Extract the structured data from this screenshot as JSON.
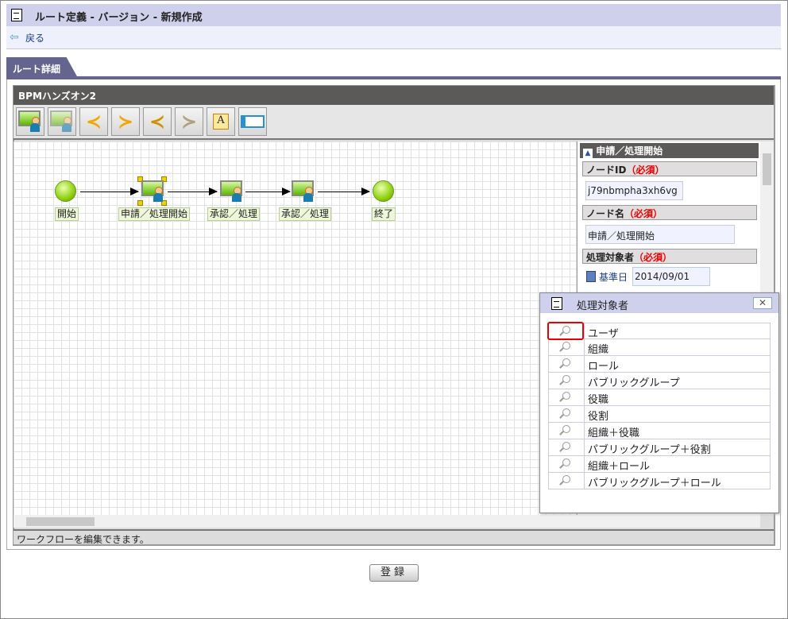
{
  "header": {
    "title": "ルート定義 - バージョン - 新規作成",
    "back_label": "戻る"
  },
  "tab": {
    "label": "ルート詳細"
  },
  "editor": {
    "title": "BPMハンズオン2",
    "status": "ワークフローを編集できます。",
    "toolbar": [
      "user-node-icon",
      "user-node-alt-icon",
      "split-icon",
      "join-icon",
      "split-alt-icon",
      "join-alt-icon",
      "annotation-icon",
      "swimlane-icon"
    ],
    "nodes": [
      {
        "label": "開始",
        "type": "start"
      },
      {
        "label": "申請／処理開始",
        "type": "user",
        "selected": true
      },
      {
        "label": "承認／処理",
        "type": "user"
      },
      {
        "label": "承認／処理",
        "type": "user"
      },
      {
        "label": "終了",
        "type": "end"
      }
    ]
  },
  "props": {
    "title": "申請／処理開始",
    "node_id_label": "ノードID",
    "node_id": "j79nbmpha3xh6vg",
    "node_name_label": "ノード名",
    "node_name": "申請／処理開始",
    "target_label": "処理対象者",
    "required": "（必須）",
    "base_date_label": "基準日",
    "base_date": "2014/09/01"
  },
  "dialog": {
    "title": "処理対象者",
    "close": "✕",
    "items": [
      "ユーザ",
      "組織",
      "ロール",
      "パブリックグループ",
      "役職",
      "役割",
      "組織＋役職",
      "パブリックグループ＋役割",
      "組織＋ロール",
      "パブリックグループ＋ロール"
    ]
  },
  "register_label": "登録"
}
